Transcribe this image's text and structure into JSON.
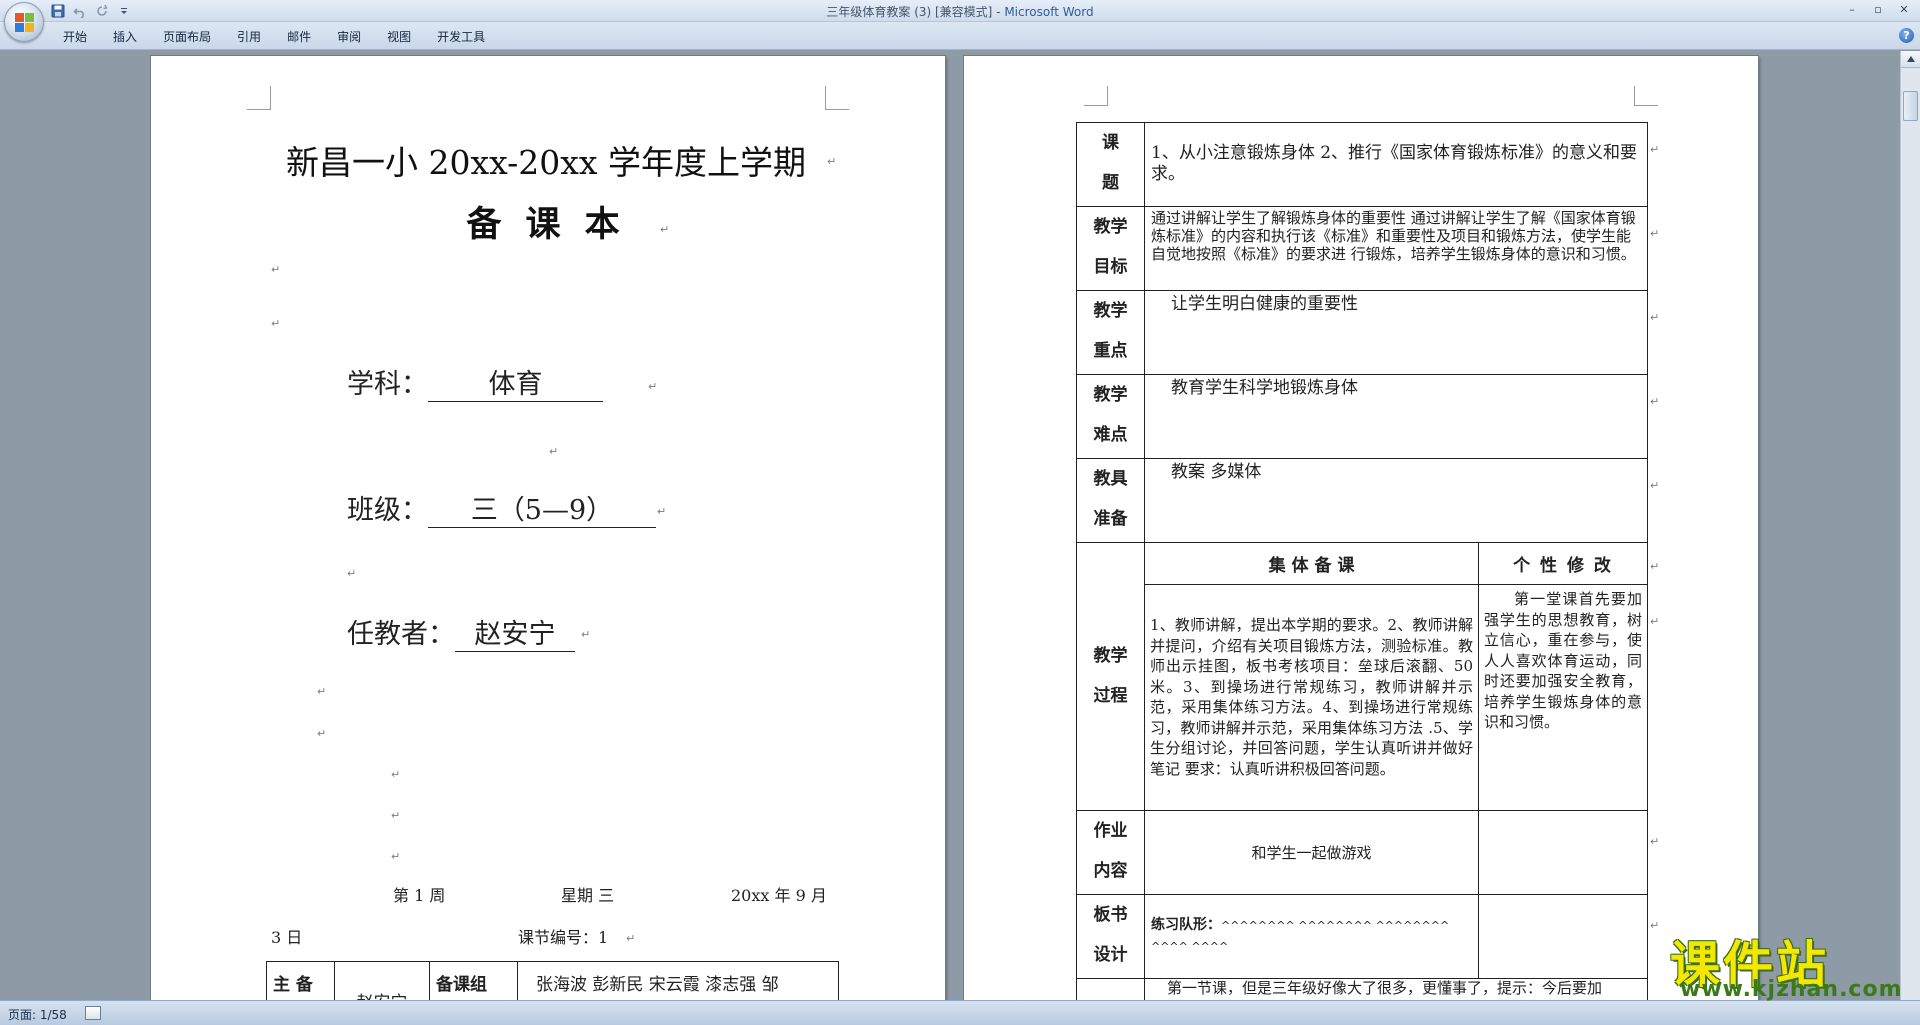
{
  "window": {
    "title": "三年级体育教案 (3) [兼容模式] - ",
    "app_name": "Microsoft Word",
    "minimize": "–",
    "restore": "▫",
    "close": "✕"
  },
  "ribbon": {
    "tabs": [
      "开始",
      "插入",
      "页面布局",
      "引用",
      "邮件",
      "审阅",
      "视图",
      "开发工具"
    ],
    "help": "?"
  },
  "page1": {
    "title_line1": "新昌一小 20xx-20xx 学年度上学期",
    "title_line2": "备 课 本",
    "subject_label": "学科：",
    "subject_value": "体育",
    "class_label": "班级：",
    "class_value": "三（5—9）",
    "teacher_label": "任教者：",
    "teacher_value": "赵安宁",
    "week": "第 1 周",
    "weekday": "星期 三",
    "date_part1": "20xx 年 9 月",
    "date_part2": "3 日",
    "lesson_no": "课节编号：1",
    "table": {
      "main_label": "主 备",
      "main_name": "赵安宁",
      "group_label": "备课组",
      "group_members": "张海波  彭新民  宋云霞  漆志强   邹"
    }
  },
  "page2": {
    "rows": [
      {
        "label": "课题",
        "content": "1、从小注意锻炼身体        2、推行《国家体育锻炼标准》的意义和要求。"
      },
      {
        "label": "教学目标",
        "content": "通过讲解让学生了解锻炼身体的重要性    通过讲解让学生了解《国家体育锻炼标准》的内容和执行该《标准》和重要性及项目和锻炼方法，使学生能自觉地按照《标准》的要求进  行锻炼，培养学生锻炼身体的意识和习惯。"
      },
      {
        "label": "教学重点",
        "content": "让学生明白健康的重要性"
      },
      {
        "label": "教学难点",
        "content": "教育学生科学地锻炼身体"
      },
      {
        "label": "教具准备",
        "content": "教案    多媒体"
      }
    ],
    "process": {
      "label": "教学过程",
      "head_collective": "集    体    备    课",
      "head_personal": "个 性 修 改",
      "collective": "1、教师讲解，提出本学期的要求。2、教师讲解并提问，介绍有关项目锻炼方法，测验标准。教师出示挂图，板书考核项目：垒球后滚翻、50 米。3、到操场进行常规练习，教师讲解并示范，采用集体练习方法。4、到操场进行常规练习，教师讲解并示范，采用集体练习方法 .5、学生分组讨论，并回答问题，学生认真听讲并做好笔记 要求：认真听讲积极回答问题。",
      "personal": "第一堂课首先要加强学生的思想教育，树立信心，重在参与，使人人喜欢体育运动，同时还要加强安全教育，培养学生锻炼身体的意识和习惯。"
    },
    "homework": {
      "label": "作业内容",
      "content": "和学生一起做游戏"
    },
    "board": {
      "label": "板书设计",
      "content_label": "练习队形：",
      "content_marks": "^^^^^^^^ ^^^^^^^^ ^^^^^^^^ ^^^^ ^^^^"
    },
    "reflection": {
      "content": "第一节课，但是三年级好像大了很多，更懂事了，提示：今后要加"
    }
  },
  "statusbar": {
    "page": "页面: 1/58"
  },
  "watermark": {
    "cn": "课件站",
    "en": "www.kjzhan.com"
  },
  "icons": {
    "office": "office-button-icon",
    "save": "save-icon",
    "undo": "undo-icon",
    "redo": "redo-icon",
    "customize": "qat-customize-icon",
    "help": "help-icon",
    "paragraph_mark": "↵"
  }
}
